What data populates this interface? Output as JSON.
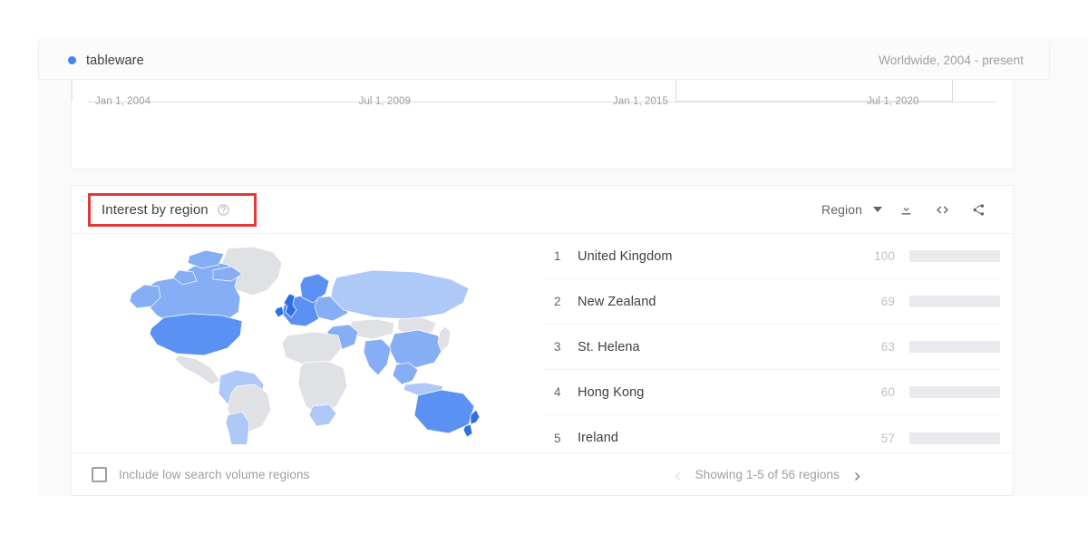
{
  "header": {
    "term": "tableware",
    "term_dot_color": "#4285f4",
    "meta": "Worldwide, 2004 - present"
  },
  "timeseries": {
    "ticks": [
      {
        "label": "Jan 1, 2004",
        "x_pct": 2.5
      },
      {
        "label": "Jul 1, 2009",
        "x_pct": 30.5
      },
      {
        "label": "Jan 1, 2015",
        "x_pct": 57.5
      },
      {
        "label": "Jul 1, 2020",
        "x_pct": 84.5
      }
    ]
  },
  "region_panel": {
    "title": "Interest by region",
    "help_icon": "help-circle-icon",
    "highlight_color": "#e53935",
    "select_label": "Region",
    "caret_icon": "chevron-down-icon",
    "tools": [
      {
        "name": "download-icon",
        "title": "Download"
      },
      {
        "name": "embed-code-icon",
        "title": "Embed"
      },
      {
        "name": "share-icon",
        "title": "Share"
      }
    ],
    "rows": [
      {
        "rank": "1",
        "name": "United Kingdom",
        "value": "100",
        "pct": 100
      },
      {
        "rank": "2",
        "name": "New Zealand",
        "value": "69",
        "pct": 69
      },
      {
        "rank": "3",
        "name": "St. Helena",
        "value": "63",
        "pct": 63
      },
      {
        "rank": "4",
        "name": "Hong Kong",
        "value": "60",
        "pct": 60
      },
      {
        "rank": "5",
        "name": "Ireland",
        "value": "57",
        "pct": 57
      }
    ],
    "bar_color": "#4285f4",
    "bar_track_color": "#e8eaed",
    "footer": {
      "checkbox_label": "Include low search volume regions",
      "checkbox_checked": false,
      "pager_text": "Showing 1-5 of 56 regions",
      "prev_icon": "chevron-left-icon",
      "next_icon": "chevron-right-icon"
    }
  },
  "map": {
    "palette": {
      "none": "#dfe1e5",
      "low": "#aec8f7",
      "mid": "#85aef5",
      "high": "#5b91f2",
      "top": "#2f6fe0"
    }
  }
}
